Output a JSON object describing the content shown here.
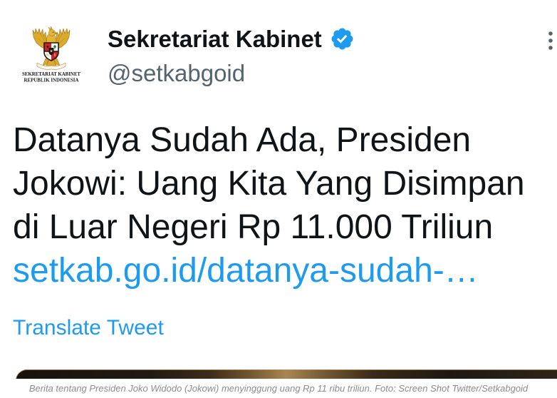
{
  "account": {
    "display_name": "Sekretariat Kabinet",
    "handle": "@setkabgoid",
    "verified": true,
    "avatar": {
      "icon": "garuda-emblem-icon",
      "logo_line1": "SEKRETARIAT KABINET",
      "logo_line2": "REPUBLIK INDONESIA"
    }
  },
  "icons": {
    "verified": "verified-badge-icon",
    "more": "more-vertical-icon"
  },
  "tweet": {
    "text": "Datanya Sudah Ada, Presiden Jokowi: Uang Kita Yang Disimpan di Luar Negeri Rp 11.000 Triliun",
    "link": "setkab.go.id/datanya-sudah-…",
    "translate_label": "Translate Tweet"
  },
  "caption": "Berita tentang Presiden Joko Widodo (Jokowi) menyinggung uang Rp 11 ribu triliun. Foto: Screen Shot Twitter/Setkabgoid",
  "colors": {
    "text": "#0f1419",
    "secondary_text": "#536471",
    "accent": "#1d9bf0",
    "caption_text": "#8c8c8c",
    "emblem_gold": "#dcab2c",
    "emblem_red": "#d2232a"
  }
}
